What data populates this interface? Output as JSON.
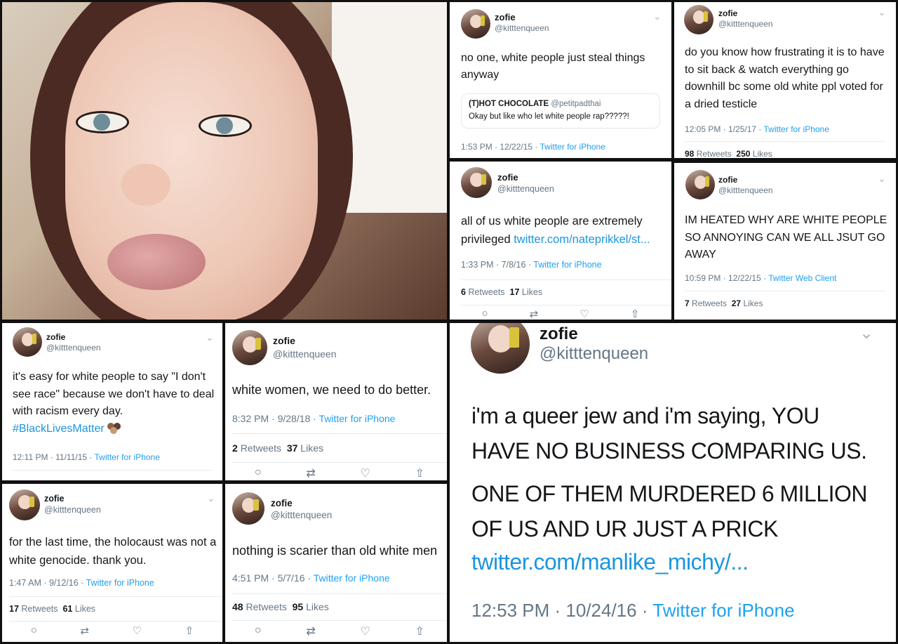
{
  "user": {
    "name": "zofie",
    "handle": "@kitttenqueen"
  },
  "tweets": {
    "t1": {
      "text": "no one, white people just steal things anyway",
      "quote_name": "(T)HOT CHOCOLATE",
      "quote_handle": "@petitpadthai",
      "quote_text": "Okay but like who let white people rap?????!",
      "time": "1:53 PM · 12/22/15 · ",
      "source": "Twitter for iPhone"
    },
    "t2": {
      "text": "do you know how frustrating it is to have to sit back & watch everything go downhill bc some old white ppl voted for a dried testicle",
      "time": "12:05 PM · 1/25/17 · ",
      "source": "Twitter for iPhone",
      "retweets": "98",
      "retweets_label": "Retweets",
      "likes": "250",
      "likes_label": "Likes"
    },
    "t3": {
      "text": "all of us white people are extremely privileged ",
      "link": "twitter.com/nateprikkel/st...",
      "time": "1:33 PM · 7/8/16 · ",
      "source": "Twitter for iPhone",
      "retweets": "6",
      "retweets_label": "Retweets",
      "likes": "17",
      "likes_label": "Likes"
    },
    "t4": {
      "text": "IM HEATED WHY ARE WHITE PEOPLE SO ANNOYING CAN WE ALL JSUT GO AWAY",
      "time": "10:59 PM · 12/22/15 · ",
      "source": "Twitter Web Client",
      "retweets": "7",
      "retweets_label": "Retweets",
      "likes": "27",
      "likes_label": "Likes"
    },
    "t5": {
      "text": "it's easy for white people to say \"I don't see race\" because we don't have to deal with racism every day.",
      "hashtag": "#BlackLivesMatter",
      "time": "12:11 PM · 11/11/15 · ",
      "source": "Twitter for iPhone"
    },
    "t6": {
      "text": "white women, we need to do better.",
      "time": "8:32 PM · 9/28/18 · ",
      "source": "Twitter for iPhone",
      "retweets": "2",
      "retweets_label": "Retweets",
      "likes": "37",
      "likes_label": "Likes"
    },
    "t7": {
      "text": "for the last time, the holocaust was not a white genocide. thank you.",
      "time": "1:47 AM · 9/12/16 · ",
      "source": "Twitter for iPhone",
      "retweets": "17",
      "retweets_label": "Retweets",
      "likes": "61",
      "likes_label": "Likes"
    },
    "t8": {
      "text": "nothing is scarier than old white men",
      "time": "4:51 PM · 5/7/16 · ",
      "source": "Twitter for iPhone",
      "retweets": "48",
      "retweets_label": "Retweets",
      "likes": "95",
      "likes_label": "Likes"
    },
    "t9": {
      "text1": "i'm a queer jew and i'm saying, YOU HAVE NO BUSINESS COMPARING US.",
      "text2": "ONE OF THEM MURDERED 6 MILLION OF US AND UR JUST A PRICK",
      "link": "twitter.com/manlike_michy/...",
      "time": "12:53 PM · 10/24/16 · ",
      "source": "Twitter for iPhone"
    }
  },
  "icons": {
    "chevron": "⌄",
    "reply": "○",
    "retweet": "⇄",
    "like": "♡",
    "share": "⇧"
  },
  "colors": {
    "link": "#1b95e0",
    "text": "#14171a",
    "muted": "#657786"
  }
}
